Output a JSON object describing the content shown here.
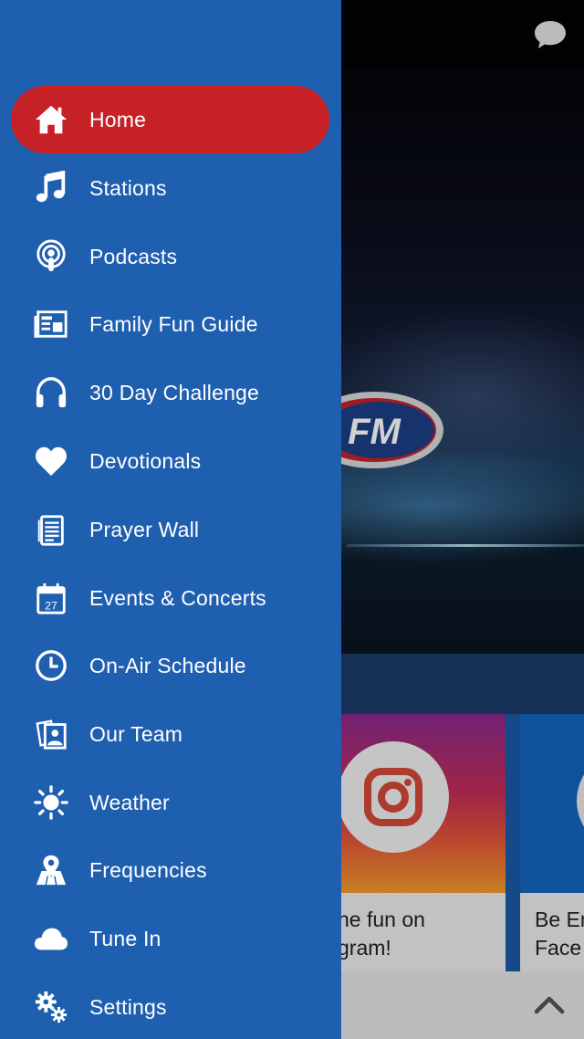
{
  "colors": {
    "drawer_bg": "#1f5fb0",
    "active_item_bg": "#c72128",
    "text": "#ffffff"
  },
  "header": {
    "chat_icon": "chat-bubble-icon"
  },
  "hero": {
    "logo_text": "FM"
  },
  "cards": [
    {
      "icon": "instagram-icon",
      "text": "he fun on\ngram!"
    },
    {
      "icon": "facebook-icon",
      "text": "Be En\nFace"
    }
  ],
  "scroll_top_icon": "chevron-up-icon",
  "nav": {
    "items": [
      {
        "label": "Home",
        "icon": "home-icon",
        "active": true
      },
      {
        "label": "Stations",
        "icon": "music-note-icon",
        "active": false
      },
      {
        "label": "Podcasts",
        "icon": "podcast-icon",
        "active": false
      },
      {
        "label": "Family Fun Guide",
        "icon": "newspaper-icon",
        "active": false
      },
      {
        "label": "30 Day Challenge",
        "icon": "headphones-icon",
        "active": false
      },
      {
        "label": "Devotionals",
        "icon": "heart-icon",
        "active": false
      },
      {
        "label": "Prayer Wall",
        "icon": "document-icon",
        "active": false
      },
      {
        "label": "Events & Concerts",
        "icon": "calendar-icon",
        "calendar_day": "27",
        "active": false
      },
      {
        "label": "On-Air Schedule",
        "icon": "clock-icon",
        "active": false
      },
      {
        "label": "Our Team",
        "icon": "photos-icon",
        "active": false
      },
      {
        "label": "Weather",
        "icon": "sun-icon",
        "active": false
      },
      {
        "label": "Frequencies",
        "icon": "map-pin-icon",
        "active": false
      },
      {
        "label": "Tune In",
        "icon": "cloud-icon",
        "active": false
      },
      {
        "label": "Settings",
        "icon": "gears-icon",
        "active": false
      }
    ]
  }
}
